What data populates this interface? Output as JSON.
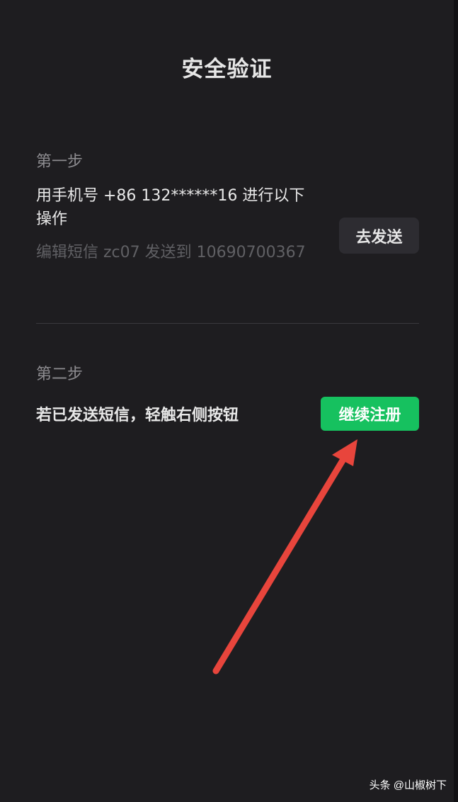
{
  "page": {
    "title": "安全验证"
  },
  "step1": {
    "label": "第一步",
    "instruction": "用手机号 +86 132******16 进行以下操作",
    "sms_info": "编辑短信 zc07 发送到 10690700367",
    "send_button": "去发送"
  },
  "step2": {
    "label": "第二步",
    "instruction": "若已发送短信，轻触右侧按钮",
    "continue_button": "继续注册"
  },
  "annotation": {
    "arrow_color": "#e8453c"
  },
  "watermark": {
    "text": "头条 @山椒树下"
  },
  "colors": {
    "background": "#1e1d20",
    "accent_green": "#16c15f",
    "secondary_button": "#2d2c31"
  }
}
